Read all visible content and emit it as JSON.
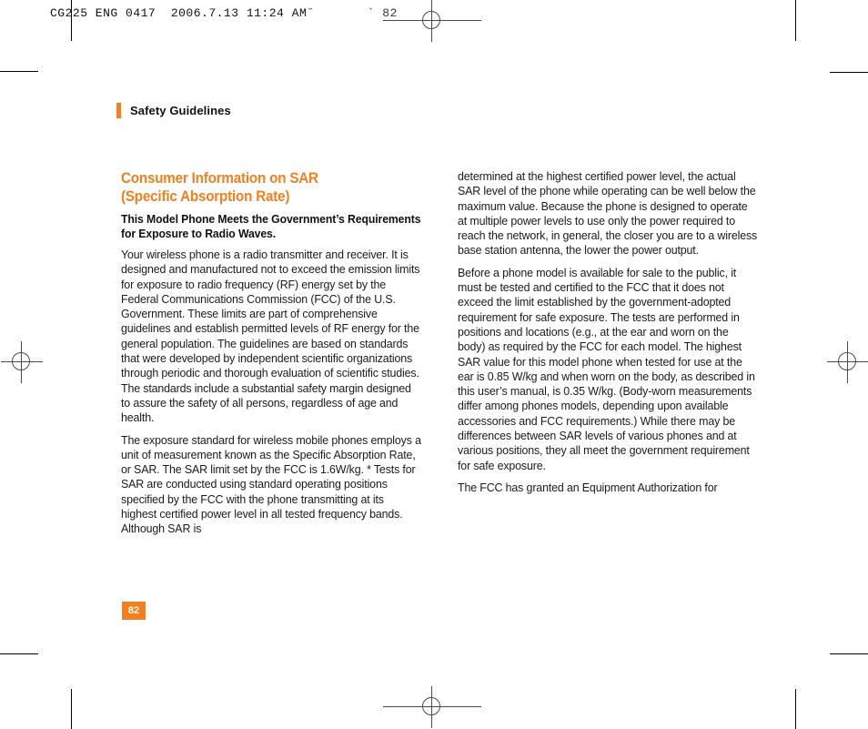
{
  "prepress": {
    "slug_line": "CG225 ENG 0417  2006.7.13 11:24 AM",
    "slug_glyphs": "˘       ` 82",
    "registration_mark_name": "registration-target"
  },
  "running_head": {
    "label": "Safety Guidelines",
    "accent_color": "#f2811d"
  },
  "document": {
    "title": "Consumer Information on SAR (Specific Absorption Rate)",
    "title_line_1": "Consumer Information on SAR",
    "title_line_2": "(Specific Absorption Rate)",
    "subtitle": "This Model Phone Meets the Government’s Requirements for Exposure to Radio Waves.",
    "title_color": "#f08020"
  },
  "columns": {
    "left": [
      "Your wireless phone is a radio transmitter and receiver. It is designed and manufactured not to exceed the emission limits for exposure to radio frequency (RF) energy set by the Federal Communications Commission (FCC) of the U.S. Government. These limits are part of comprehensive guidelines and establish permitted levels of RF energy for the general population. The guidelines are based on standards that were developed by independent scientific organizations through periodic and thorough evaluation of scientific studies. The standards include a substantial safety margin designed to assure the safety of all persons, regardless of age and health.",
      "The exposure standard for wireless mobile phones employs a unit of measurement known as the Specific Absorption Rate, or SAR. The SAR limit set by the FCC is 1.6W/kg. * Tests for SAR are conducted using standard operating positions specified by the FCC with the phone transmitting at its highest certified power level in all tested frequency bands. Although SAR is"
    ],
    "right": [
      "determined at the highest certified power level, the actual SAR level of the phone while operating can be well below the maximum value. Because the phone is designed to operate at multiple power levels to use only the power required to reach the network, in general, the closer you are to a wireless base station antenna, the lower the power output.",
      "Before a phone model is available for sale to the public, it must be tested and certified to the FCC that it does not exceed the limit established by the government-adopted requirement for safe exposure. The tests are performed in positions and locations (e.g., at the ear and worn on the body) as required by the FCC for each model. The highest SAR value for this model phone when tested for use at the ear is 0.85 W/kg and when worn on the body, as described in this user’s manual, is 0.35 W/kg. (Body-worn measurements differ among phones models, depending upon available accessories and FCC requirements.) While there may be differences between SAR levels of various phones and at various positions, they all meet the government requirement for safe exposure.",
      "The FCC has granted an Equipment Authorization for"
    ]
  },
  "folio": {
    "page_number": "82",
    "background_color": "#f2811d",
    "text_color": "#ffffff"
  }
}
